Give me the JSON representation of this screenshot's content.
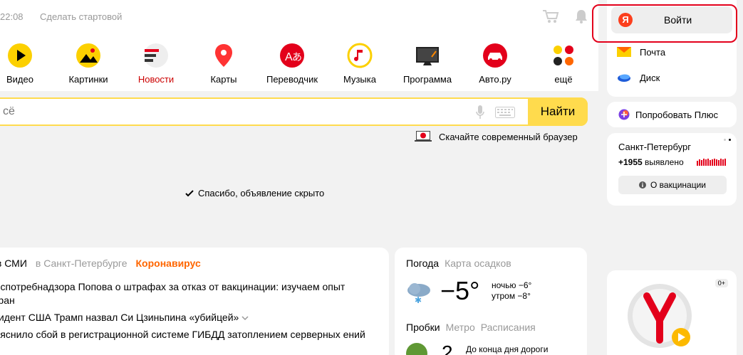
{
  "header": {
    "time": "22:08",
    "make_start": "Сделать стартовой"
  },
  "services": [
    {
      "label": "Видео",
      "icon": "video-icon"
    },
    {
      "label": "Картинки",
      "icon": "images-icon"
    },
    {
      "label": "Новости",
      "icon": "news-icon",
      "color": "#cc0000"
    },
    {
      "label": "Карты",
      "icon": "maps-icon"
    },
    {
      "label": "Переводчик",
      "icon": "translate-icon"
    },
    {
      "label": "Музыка",
      "icon": "music-icon"
    },
    {
      "label": "Программа",
      "icon": "tv-program-icon"
    },
    {
      "label": "Авто.ру",
      "icon": "auto-icon"
    },
    {
      "label": "ещё",
      "icon": "more-icon"
    }
  ],
  "search": {
    "placeholder": "сё",
    "button_label": "Найти",
    "browser_promo": "Скачайте современный браузер"
  },
  "ad": {
    "hidden_message": "Спасибо, объявление скрыто"
  },
  "news": {
    "tabs": [
      {
        "label": "с в СМИ"
      },
      {
        "label": "в Санкт-Петербурге"
      },
      {
        "label": "Коронавирус"
      }
    ],
    "items": [
      "Роспотребнадзора Попова о штрафах за отказ от вакцинации: изучаем опыт стран",
      "езидент США Трамп назвал Си Цзиньпина «убийцей»",
      "бъяснило сбой в регистрационной системе ГИБДД затоплением серверных ений"
    ]
  },
  "weather": {
    "title": "Погода",
    "map_link": "Карта осадков",
    "temp": "−5°",
    "night": "ночью −6°",
    "morning": "утром −8°",
    "traffic_tabs": [
      "Пробки",
      "Метро",
      "Расписания"
    ],
    "traffic_score": "2",
    "traffic_note": "До конца дня дороги"
  },
  "user": {
    "login_label": "Войти",
    "mail_label": "Почта",
    "disk_label": "Диск"
  },
  "plus": {
    "label": "Попробовать Плюс"
  },
  "covid": {
    "city": "Санкт-Петербург",
    "count": "+1955",
    "count_suffix": "выявлено",
    "vax_button": "О вакцинации"
  },
  "promo": {
    "age": "0+"
  },
  "colors": {
    "search_accent": "#ffdb4d",
    "yandex_red": "#fc3f1d",
    "covid_orange": "#ff6600",
    "highlight": "#e3001b"
  }
}
